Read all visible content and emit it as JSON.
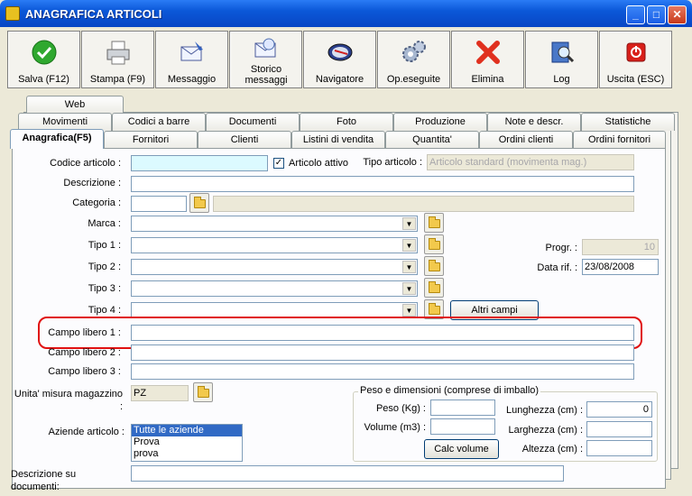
{
  "window": {
    "title": "ANAGRAFICA ARTICOLI"
  },
  "toolbar": [
    {
      "label": "Salva (F12)",
      "icon": "save-check-icon"
    },
    {
      "label": "Stampa (F9)",
      "icon": "printer-icon"
    },
    {
      "label": "Messaggio",
      "icon": "message-envelope-icon"
    },
    {
      "label": "Storico messaggi",
      "icon": "message-history-icon"
    },
    {
      "label": "Navigatore",
      "icon": "navigator-icon"
    },
    {
      "label": "Op.eseguite",
      "icon": "gears-icon"
    },
    {
      "label": "Elimina",
      "icon": "delete-x-icon"
    },
    {
      "label": "Log",
      "icon": "log-icon"
    },
    {
      "label": "Uscita (ESC)",
      "icon": "exit-icon"
    }
  ],
  "tabs": {
    "row4": [
      "Web"
    ],
    "row3": [
      "Movimenti",
      "Codici a barre",
      "Documenti",
      "Foto",
      "Produzione",
      "Note e descr.",
      "Statistiche"
    ],
    "row2": [
      "Anagrafica(F5)",
      "Fornitori",
      "Clienti",
      "Listini di vendita",
      "Quantita'",
      "Ordini clienti",
      "Ordini fornitori"
    ]
  },
  "form": {
    "codice_label": "Codice articolo :",
    "codice_value": "",
    "attivo_label": "Articolo attivo",
    "tipo_articolo_label": "Tipo articolo :",
    "tipo_articolo_value": "Articolo standard (movimenta mag.)",
    "descrizione_label": "Descrizione :",
    "categoria_label": "Categoria :",
    "marca_label": "Marca :",
    "tipo1_label": "Tipo 1 :",
    "tipo2_label": "Tipo 2 :",
    "tipo3_label": "Tipo 3 :",
    "tipo4_label": "Tipo 4 :",
    "altri_campi": "Altri campi",
    "progr_label": "Progr. :",
    "progr_value": "10",
    "data_label": "Data rif. :",
    "data_value": "23/08/2008",
    "campo1_label": "Campo libero 1 :",
    "campo2_label": "Campo libero 2 :",
    "campo3_label": "Campo libero 3 :",
    "um_label": "Unita' misura magazzino :",
    "um_value": "PZ",
    "aziende_label": "Aziende articolo :",
    "aziende_items": [
      "Tutte le aziende",
      "Prova",
      "prova"
    ],
    "desc_doc_label": "Descrizione su documenti:",
    "peso_group": "Peso e dimensioni (comprese di imballo)",
    "peso_label": "Peso (Kg) :",
    "volume_label": "Volume (m3) :",
    "lunghezza_label": "Lunghezza (cm) :",
    "lunghezza_value": "0",
    "larghezza_label": "Larghezza (cm) :",
    "altezza_label": "Altezza (cm) :",
    "calc_volume": "Calc volume"
  }
}
